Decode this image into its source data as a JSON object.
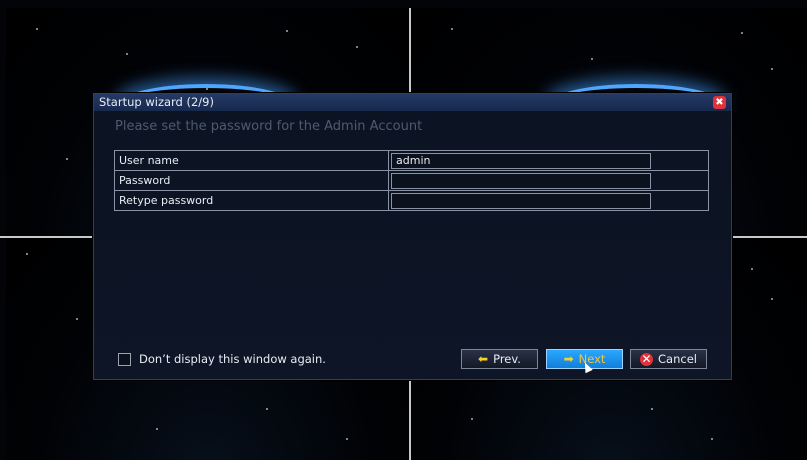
{
  "dialog": {
    "title": "Startup wizard (2/9)",
    "close_glyph": "✖",
    "subtitle": "Please set the password for the Admin Account",
    "fields": [
      {
        "label": "User name",
        "value": "admin",
        "placeholder": ""
      },
      {
        "label": "Password",
        "value": "",
        "placeholder": ""
      },
      {
        "label": "Retype password",
        "value": "",
        "placeholder": ""
      }
    ],
    "checkbox_label": "Don’t display this window again.",
    "checkbox_checked": false,
    "buttons": {
      "prev": "Prev.",
      "next": "Next",
      "cancel": "Cancel"
    }
  },
  "icons": {
    "prev": "left-arrow-icon",
    "next": "right-arrow-icon",
    "cancel": "close-circle-icon",
    "close": "close-icon"
  },
  "colors": {
    "titlebar": "#243a66",
    "next_button": "#1f96f2",
    "close_red": "#e0323a",
    "arrow_yellow": "#f1d32a"
  }
}
